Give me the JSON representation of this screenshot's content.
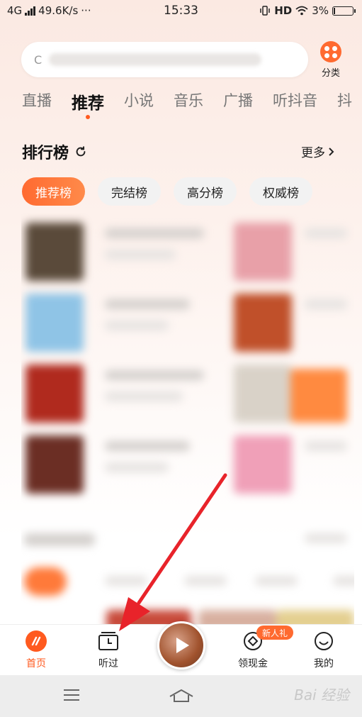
{
  "status_bar": {
    "network": "4G",
    "speed": "49.6K/s",
    "more": "···",
    "time": "15:33",
    "hd": "HD",
    "battery": "3%"
  },
  "search": {
    "placeholder": "C"
  },
  "category": {
    "label": "分类"
  },
  "tabs": [
    {
      "label": "直播"
    },
    {
      "label": "推荐",
      "active": true
    },
    {
      "label": "小说"
    },
    {
      "label": "音乐"
    },
    {
      "label": "广播"
    },
    {
      "label": "听抖音"
    },
    {
      "label": "抖"
    }
  ],
  "ranking": {
    "title": "排行榜",
    "more": "更多",
    "chips": [
      {
        "label": "推荐榜",
        "active": true
      },
      {
        "label": "完结榜"
      },
      {
        "label": "高分榜"
      },
      {
        "label": "权威榜"
      }
    ]
  },
  "bottom_nav": {
    "home": "首页",
    "history": "听过",
    "cash": "领现金",
    "cash_badge": "新人礼",
    "mine": "我的"
  },
  "watermark": "Bai 经验",
  "colors": {
    "accent": "#ff5a1f",
    "arrow": "#e8232a"
  }
}
